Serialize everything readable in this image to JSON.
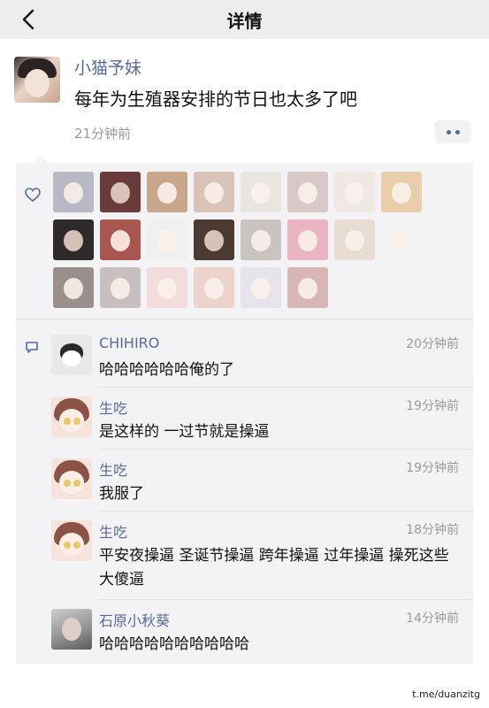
{
  "header": {
    "title": "详情",
    "back_icon": "chevron-left-icon"
  },
  "post": {
    "author": "小猫予妹",
    "text": "每年为生殖器安排的节日也太多了吧",
    "time": "21分钟前",
    "more_icon": "ellipsis-icon"
  },
  "likes": {
    "icon": "heart-icon",
    "avatar_colors": [
      "#b9b9c6",
      "#6a3b3b",
      "#c8a78b",
      "#d9c2b8",
      "#e9e6df",
      "#d8c8c8",
      "#efe9e4",
      "#e8cfa9",
      "#2e2a2a",
      "#a8564e",
      "#f0f0f0",
      "#4b3a32",
      "#c9c4c0",
      "#eab4c2",
      "#e7ddd2",
      "#f2f2f2",
      "#9a8f8a",
      "#c8c0c0",
      "#f4dcdc",
      "#ecd3cc",
      "#e4e4ea",
      "#d8b6b6"
    ]
  },
  "comments": {
    "icon": "comment-icon",
    "items": [
      {
        "name": "CHIHIRO",
        "time": "20分钟前",
        "text": "哈哈哈哈哈哈俺的了",
        "avatar": "cat"
      },
      {
        "name": "生吃",
        "time": "19分钟前",
        "text": "是这样的 一过节就是操逼",
        "avatar": "girl"
      },
      {
        "name": "生吃",
        "time": "19分钟前",
        "text": "我服了",
        "avatar": "girl"
      },
      {
        "name": "生吃",
        "time": "18分钟前",
        "text": "平安夜操逼 圣诞节操逼 跨年操逼 过年操逼 操死这些大傻逼",
        "avatar": "girl"
      },
      {
        "name": "石原小秋葵",
        "time": "14分钟前",
        "text": "哈哈哈哈哈哈哈哈哈哈",
        "avatar": "photo"
      }
    ]
  },
  "watermark": "t.me/duanzitg"
}
